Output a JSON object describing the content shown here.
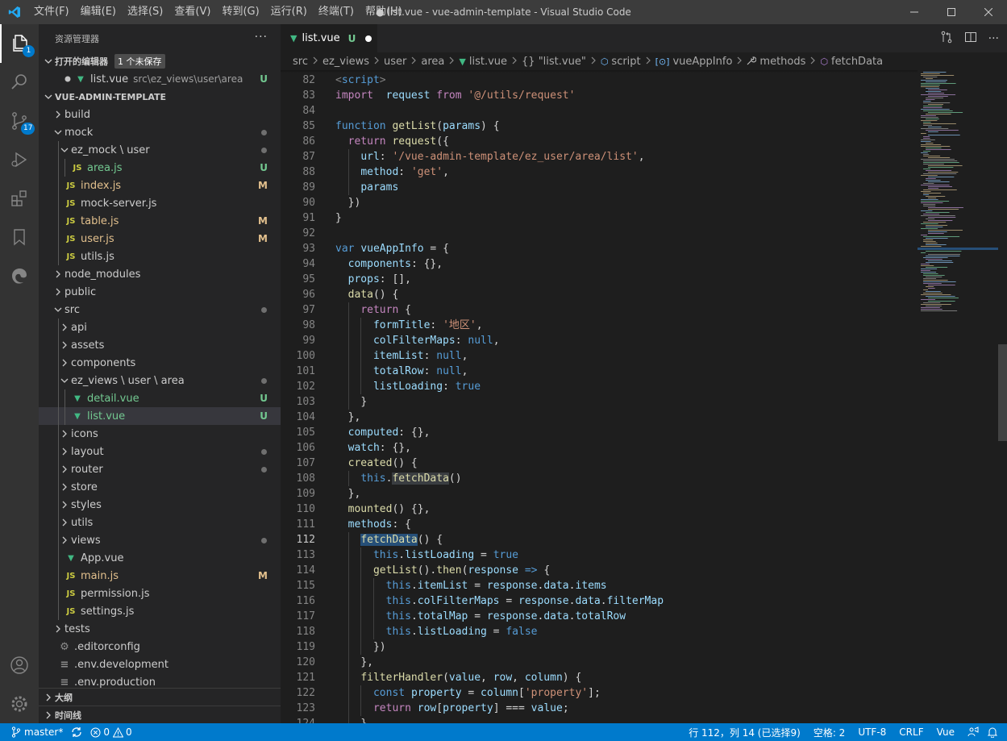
{
  "window": {
    "title": "● list.vue - vue-admin-template - Visual Studio Code",
    "menu": [
      "文件(F)",
      "编辑(E)",
      "选择(S)",
      "查看(V)",
      "转到(G)",
      "运行(R)",
      "终端(T)",
      "帮助(H)"
    ]
  },
  "activitybar": {
    "explorer_badge": "1",
    "scm_badge": "17",
    "icons": [
      "explorer-icon",
      "search-icon",
      "source-control-icon",
      "run-debug-icon",
      "extensions-icon",
      "bookmarks-icon",
      "edge-devtools-icon",
      "account-icon",
      "settings-gear-icon"
    ]
  },
  "sidebar": {
    "title": "资源管理器",
    "more_label": "···",
    "open_editors": {
      "header": "打开的编辑器",
      "unsaved_badge": "1 个未保存",
      "items": [
        {
          "name": "list.vue",
          "path": "src\\ez_views\\user\\area",
          "status": "U"
        }
      ]
    },
    "project": {
      "header": "VUE-ADMIN-TEMPLATE",
      "rows": [
        {
          "label": "build",
          "type": "folder",
          "open": false,
          "depth": 0,
          "status": ""
        },
        {
          "label": "mock",
          "type": "folder",
          "open": true,
          "depth": 0,
          "status": "dot"
        },
        {
          "label": "ez_mock \\ user",
          "type": "folder",
          "open": true,
          "depth": 1,
          "status": "dot"
        },
        {
          "label": "area.js",
          "type": "js",
          "depth": 2,
          "status": "U"
        },
        {
          "label": "index.js",
          "type": "js",
          "depth": 1,
          "status": "M"
        },
        {
          "label": "mock-server.js",
          "type": "js",
          "depth": 1,
          "status": ""
        },
        {
          "label": "table.js",
          "type": "js",
          "depth": 1,
          "status": "M"
        },
        {
          "label": "user.js",
          "type": "js",
          "depth": 1,
          "status": "M"
        },
        {
          "label": "utils.js",
          "type": "js",
          "depth": 1,
          "status": ""
        },
        {
          "label": "node_modules",
          "type": "folder",
          "open": false,
          "depth": 0,
          "status": ""
        },
        {
          "label": "public",
          "type": "folder",
          "open": false,
          "depth": 0,
          "status": ""
        },
        {
          "label": "src",
          "type": "folder",
          "open": true,
          "depth": 0,
          "status": "dot"
        },
        {
          "label": "api",
          "type": "folder",
          "open": false,
          "depth": 1,
          "status": ""
        },
        {
          "label": "assets",
          "type": "folder",
          "open": false,
          "depth": 1,
          "status": ""
        },
        {
          "label": "components",
          "type": "folder",
          "open": false,
          "depth": 1,
          "status": ""
        },
        {
          "label": "ez_views \\ user \\ area",
          "type": "folder",
          "open": true,
          "depth": 1,
          "status": "dot"
        },
        {
          "label": "detail.vue",
          "type": "vue",
          "depth": 2,
          "status": "U"
        },
        {
          "label": "list.vue",
          "type": "vue",
          "depth": 2,
          "status": "U",
          "selected": true
        },
        {
          "label": "icons",
          "type": "folder",
          "open": false,
          "depth": 1,
          "status": ""
        },
        {
          "label": "layout",
          "type": "folder",
          "open": false,
          "depth": 1,
          "status": "dot"
        },
        {
          "label": "router",
          "type": "folder",
          "open": false,
          "depth": 1,
          "status": "dot"
        },
        {
          "label": "store",
          "type": "folder",
          "open": false,
          "depth": 1,
          "status": ""
        },
        {
          "label": "styles",
          "type": "folder",
          "open": false,
          "depth": 1,
          "status": ""
        },
        {
          "label": "utils",
          "type": "folder",
          "open": false,
          "depth": 1,
          "status": ""
        },
        {
          "label": "views",
          "type": "folder",
          "open": false,
          "depth": 1,
          "status": "dot"
        },
        {
          "label": "App.vue",
          "type": "vue",
          "depth": 1,
          "status": ""
        },
        {
          "label": "main.js",
          "type": "js",
          "depth": 1,
          "status": "M"
        },
        {
          "label": "permission.js",
          "type": "js",
          "depth": 1,
          "status": ""
        },
        {
          "label": "settings.js",
          "type": "js",
          "depth": 1,
          "status": ""
        },
        {
          "label": "tests",
          "type": "folder",
          "open": false,
          "depth": 0,
          "status": ""
        },
        {
          "label": ".editorconfig",
          "type": "gear",
          "depth": 0,
          "status": ""
        },
        {
          "label": ".env.development",
          "type": "env",
          "depth": 0,
          "status": ""
        },
        {
          "label": ".env.production",
          "type": "env",
          "depth": 0,
          "status": ""
        }
      ]
    },
    "outline_label": "大纲",
    "timeline_label": "时间线"
  },
  "editor": {
    "tab": {
      "name": "list.vue",
      "status": "U"
    },
    "breadcrumb": [
      "src",
      "ez_views",
      "user",
      "area",
      "list.vue",
      "{} \"list.vue\"",
      "script",
      "vueAppInfo",
      "methods",
      "fetchData"
    ],
    "current_line": 112,
    "lines": [
      {
        "n": 82,
        "i": 0,
        "t": [
          [
            "tag",
            "<"
          ],
          [
            "tagname",
            "script"
          ],
          [
            "tag",
            ">"
          ]
        ]
      },
      {
        "n": 83,
        "i": 0,
        "t": [
          [
            "kw",
            "import"
          ],
          [
            "",
            "  "
          ],
          [
            "var",
            "request"
          ],
          [
            "",
            " "
          ],
          [
            "kw",
            "from"
          ],
          [
            "",
            " "
          ],
          [
            "str",
            "'@/utils/request'"
          ]
        ]
      },
      {
        "n": 84,
        "i": 0,
        "t": []
      },
      {
        "n": 85,
        "i": 0,
        "t": [
          [
            "stor",
            "function"
          ],
          [
            "",
            " "
          ],
          [
            "fn",
            "getList"
          ],
          [
            "",
            "("
          ],
          [
            "var",
            "params"
          ],
          [
            "",
            ") {"
          ]
        ]
      },
      {
        "n": 86,
        "i": 1,
        "t": [
          [
            "kw",
            "return"
          ],
          [
            "",
            " "
          ],
          [
            "fn",
            "request"
          ],
          [
            "",
            "({"
          ]
        ]
      },
      {
        "n": 87,
        "i": 2,
        "t": [
          [
            "var",
            "url"
          ],
          [
            "",
            ": "
          ],
          [
            "str",
            "'/vue-admin-template/ez_user/area/list'"
          ],
          [
            "",
            ","
          ]
        ]
      },
      {
        "n": 88,
        "i": 2,
        "t": [
          [
            "var",
            "method"
          ],
          [
            "",
            ": "
          ],
          [
            "str",
            "'get'"
          ],
          [
            "",
            ","
          ]
        ]
      },
      {
        "n": 89,
        "i": 2,
        "t": [
          [
            "var",
            "params"
          ]
        ]
      },
      {
        "n": 90,
        "i": 1,
        "t": [
          [
            "",
            "})"
          ]
        ]
      },
      {
        "n": 91,
        "i": 0,
        "t": [
          [
            "",
            "}"
          ]
        ]
      },
      {
        "n": 92,
        "i": 0,
        "t": []
      },
      {
        "n": 93,
        "i": 0,
        "t": [
          [
            "stor",
            "var"
          ],
          [
            "",
            " "
          ],
          [
            "var",
            "vueAppInfo"
          ],
          [
            "",
            " = {"
          ]
        ]
      },
      {
        "n": 94,
        "i": 1,
        "t": [
          [
            "var",
            "components"
          ],
          [
            "",
            ": {},"
          ]
        ]
      },
      {
        "n": 95,
        "i": 1,
        "t": [
          [
            "var",
            "props"
          ],
          [
            "",
            ": [],"
          ]
        ]
      },
      {
        "n": 96,
        "i": 1,
        "t": [
          [
            "fn",
            "data"
          ],
          [
            "",
            "() {"
          ]
        ]
      },
      {
        "n": 97,
        "i": 2,
        "t": [
          [
            "kw",
            "return"
          ],
          [
            "",
            " {"
          ]
        ]
      },
      {
        "n": 98,
        "i": 3,
        "t": [
          [
            "var",
            "formTitle"
          ],
          [
            "",
            ": "
          ],
          [
            "str",
            "'地区'"
          ],
          [
            "",
            ","
          ]
        ]
      },
      {
        "n": 99,
        "i": 3,
        "t": [
          [
            "var",
            "colFilterMaps"
          ],
          [
            "",
            ": "
          ],
          [
            "stor",
            "null"
          ],
          [
            "",
            ","
          ]
        ]
      },
      {
        "n": 100,
        "i": 3,
        "t": [
          [
            "var",
            "itemList"
          ],
          [
            "",
            ": "
          ],
          [
            "stor",
            "null"
          ],
          [
            "",
            ","
          ]
        ]
      },
      {
        "n": 101,
        "i": 3,
        "t": [
          [
            "var",
            "totalRow"
          ],
          [
            "",
            ": "
          ],
          [
            "stor",
            "null"
          ],
          [
            "",
            ","
          ]
        ]
      },
      {
        "n": 102,
        "i": 3,
        "t": [
          [
            "var",
            "listLoading"
          ],
          [
            "",
            ": "
          ],
          [
            "stor",
            "true"
          ]
        ]
      },
      {
        "n": 103,
        "i": 2,
        "t": [
          [
            "",
            "}"
          ]
        ]
      },
      {
        "n": 104,
        "i": 1,
        "t": [
          [
            "",
            "},"
          ]
        ]
      },
      {
        "n": 105,
        "i": 1,
        "t": [
          [
            "var",
            "computed"
          ],
          [
            "",
            ": {},"
          ]
        ]
      },
      {
        "n": 106,
        "i": 1,
        "t": [
          [
            "var",
            "watch"
          ],
          [
            "",
            ": {},"
          ]
        ]
      },
      {
        "n": 107,
        "i": 1,
        "t": [
          [
            "fn",
            "created"
          ],
          [
            "",
            "() {"
          ]
        ]
      },
      {
        "n": 108,
        "i": 2,
        "t": [
          [
            "stor",
            "this"
          ],
          [
            "",
            "."
          ],
          [
            "fnhl",
            "fetchData"
          ],
          [
            "",
            "()"
          ]
        ]
      },
      {
        "n": 109,
        "i": 1,
        "t": [
          [
            "",
            "},"
          ]
        ]
      },
      {
        "n": 110,
        "i": 1,
        "t": [
          [
            "fn",
            "mounted"
          ],
          [
            "",
            "() {},"
          ]
        ]
      },
      {
        "n": 111,
        "i": 1,
        "t": [
          [
            "var",
            "methods"
          ],
          [
            "",
            ": {"
          ]
        ]
      },
      {
        "n": 112,
        "i": 2,
        "t": [
          [
            "fnsel",
            "fetchData"
          ],
          [
            "",
            "() {"
          ]
        ]
      },
      {
        "n": 113,
        "i": 3,
        "t": [
          [
            "stor",
            "this"
          ],
          [
            "",
            "."
          ],
          [
            "var",
            "listLoading"
          ],
          [
            "",
            " = "
          ],
          [
            "stor",
            "true"
          ]
        ]
      },
      {
        "n": 114,
        "i": 3,
        "t": [
          [
            "fn",
            "getList"
          ],
          [
            "",
            "()."
          ],
          [
            "fn",
            "then"
          ],
          [
            "",
            "("
          ],
          [
            "var",
            "response"
          ],
          [
            "",
            " "
          ],
          [
            "stor",
            "=>"
          ],
          [
            "",
            " {"
          ]
        ]
      },
      {
        "n": 115,
        "i": 4,
        "t": [
          [
            "stor",
            "this"
          ],
          [
            "",
            "."
          ],
          [
            "var",
            "itemList"
          ],
          [
            "",
            " = "
          ],
          [
            "var",
            "response"
          ],
          [
            "",
            "."
          ],
          [
            "var",
            "data"
          ],
          [
            "",
            "."
          ],
          [
            "var",
            "items"
          ]
        ]
      },
      {
        "n": 116,
        "i": 4,
        "t": [
          [
            "stor",
            "this"
          ],
          [
            "",
            "."
          ],
          [
            "var",
            "colFilterMaps"
          ],
          [
            "",
            " = "
          ],
          [
            "var",
            "response"
          ],
          [
            "",
            "."
          ],
          [
            "var",
            "data"
          ],
          [
            "",
            "."
          ],
          [
            "var",
            "filterMap"
          ]
        ]
      },
      {
        "n": 117,
        "i": 4,
        "t": [
          [
            "stor",
            "this"
          ],
          [
            "",
            "."
          ],
          [
            "var",
            "totalMap"
          ],
          [
            "",
            " = "
          ],
          [
            "var",
            "response"
          ],
          [
            "",
            "."
          ],
          [
            "var",
            "data"
          ],
          [
            "",
            "."
          ],
          [
            "var",
            "totalRow"
          ]
        ]
      },
      {
        "n": 118,
        "i": 4,
        "t": [
          [
            "stor",
            "this"
          ],
          [
            "",
            "."
          ],
          [
            "var",
            "listLoading"
          ],
          [
            "",
            " = "
          ],
          [
            "stor",
            "false"
          ]
        ]
      },
      {
        "n": 119,
        "i": 3,
        "t": [
          [
            "",
            "})"
          ]
        ]
      },
      {
        "n": 120,
        "i": 2,
        "t": [
          [
            "",
            "},"
          ]
        ]
      },
      {
        "n": 121,
        "i": 2,
        "t": [
          [
            "fn",
            "filterHandler"
          ],
          [
            "",
            "("
          ],
          [
            "var",
            "value"
          ],
          [
            "",
            ", "
          ],
          [
            "var",
            "row"
          ],
          [
            "",
            ", "
          ],
          [
            "var",
            "column"
          ],
          [
            "",
            ") {"
          ]
        ]
      },
      {
        "n": 122,
        "i": 3,
        "t": [
          [
            "stor",
            "const"
          ],
          [
            "",
            " "
          ],
          [
            "var",
            "property"
          ],
          [
            "",
            " = "
          ],
          [
            "var",
            "column"
          ],
          [
            "",
            "["
          ],
          [
            "str",
            "'property'"
          ],
          [
            "",
            "];"
          ]
        ]
      },
      {
        "n": 123,
        "i": 3,
        "t": [
          [
            "kw",
            "return"
          ],
          [
            "",
            " "
          ],
          [
            "var",
            "row"
          ],
          [
            "",
            "["
          ],
          [
            "var",
            "property"
          ],
          [
            "",
            "] === "
          ],
          [
            "var",
            "value"
          ],
          [
            "",
            ";"
          ]
        ]
      },
      {
        "n": 124,
        "i": 2,
        "t": [
          [
            "",
            "},"
          ]
        ]
      }
    ]
  },
  "statusbar": {
    "branch": "master*",
    "errors": "0",
    "warnings": "0",
    "position": "行 112，列 14 (已选择9)",
    "spaces": "空格: 2",
    "encoding": "UTF-8",
    "eol": "CRLF",
    "language": "Vue"
  },
  "colors": {
    "accent": "#007acc",
    "untracked": "#73c991",
    "modified": "#e2c08d"
  }
}
